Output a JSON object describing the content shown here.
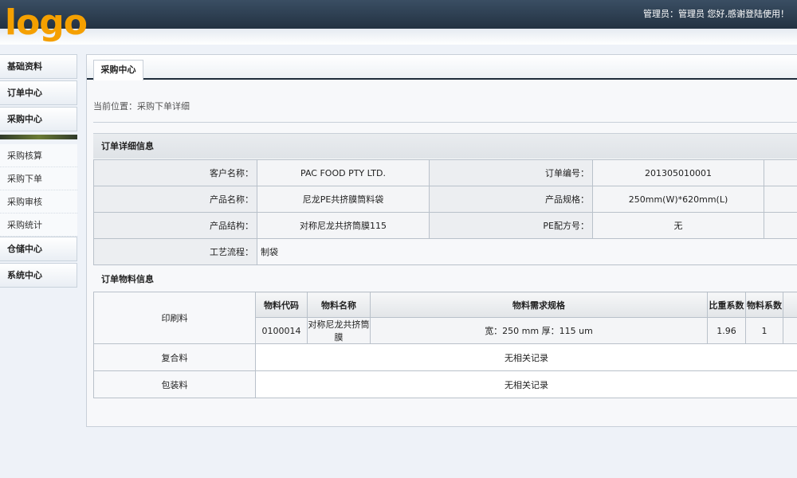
{
  "header": {
    "logo_text": "logo",
    "welcome_text": "管理员：管理员 您好,感谢登陆使用！"
  },
  "sidebar": {
    "groups_top": [
      "基础资料",
      "订单中心",
      "采购中心"
    ],
    "items": [
      "采购核算",
      "采购下单",
      "采购审核",
      "采购统计"
    ],
    "groups_bottom": [
      "仓储中心",
      "系统中心"
    ]
  },
  "main": {
    "tab_label": "采购中心",
    "location_text": "当前位置：采购下单详细",
    "order_section_title": "订单详细信息",
    "order_fields": {
      "customer_label": "客户名称：",
      "customer_value": "PAC FOOD PTY LTD.",
      "order_no_label": "订单编号：",
      "order_no_value": "201305010001",
      "product_name_label": "产品名称：",
      "product_name_value": "尼龙PE共挤膜筒料袋",
      "product_spec_label": "产品规格：",
      "product_spec_value": "250mm(W)*620mm(L)",
      "product_structure_label": "产品结构：",
      "product_structure_value": "对称尼龙共挤筒膜115",
      "pe_formula_label": "PE配方号：",
      "pe_formula_value": "无",
      "process_label": "工艺流程：",
      "process_value": "制袋"
    },
    "material_section_title": "订单物料信息",
    "materials": {
      "printing_label": "印刷料",
      "columns": [
        "物料代码",
        "物料名称",
        "物料需求规格",
        "比重系数",
        "物料系数"
      ],
      "row": [
        "0100014",
        "对称尼龙共挤筒膜",
        "宽：250 mm 厚：115 um",
        "1.96",
        "1"
      ],
      "composite_label": "复合料",
      "composite_value": "无相关记录",
      "packaging_label": "包装料",
      "packaging_value": "无相关记录"
    }
  },
  "colors": {
    "header_dark": "#233242",
    "logo": "#f5a000",
    "accent_divider": "#6a7b35"
  }
}
